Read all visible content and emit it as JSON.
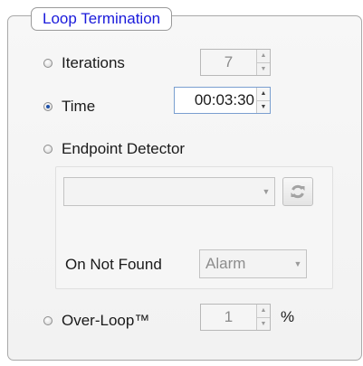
{
  "group": {
    "title": "Loop Termination"
  },
  "options": {
    "iterations": {
      "label": "Iterations",
      "value": "7",
      "selected": false
    },
    "time": {
      "label": "Time",
      "value": "00:03:30",
      "selected": true
    },
    "endpoint": {
      "label": "Endpoint Detector",
      "selected": false,
      "detector_value": "",
      "on_not_found_label": "On Not Found",
      "on_not_found_value": "Alarm"
    },
    "overloop": {
      "label": "Over-Loop™",
      "value": "1",
      "unit": "%",
      "selected": false
    }
  },
  "icons": {
    "spin_up": "▲",
    "spin_down": "▼",
    "dropdown": "▼",
    "refresh": "refresh-icon"
  }
}
